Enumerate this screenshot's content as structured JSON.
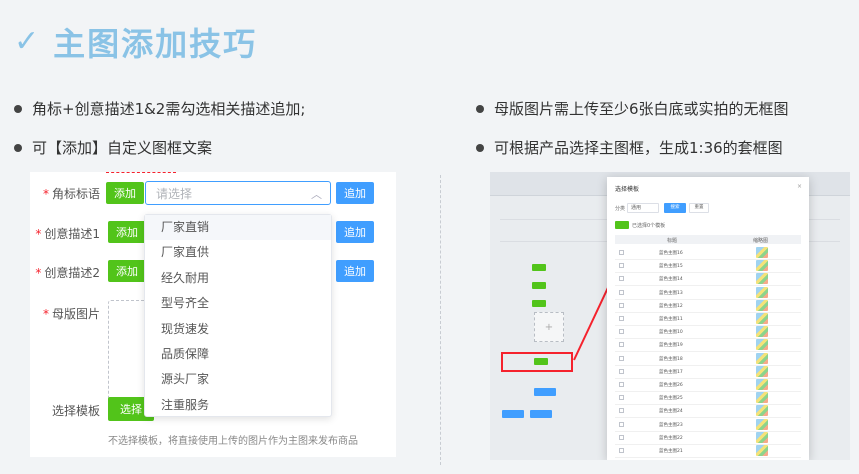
{
  "title": {
    "check": "✓",
    "text": "主图添加技巧"
  },
  "bullets": [
    "角标+创意描述1&2需勾选相关描述追加;",
    "可【添加】自定义图框文案",
    "母版图片需上传至少6张白底或实拍的无框图",
    "可根据产品选择主图框，生成1:36的套框图"
  ],
  "form": {
    "fields": [
      {
        "label": "角标标语",
        "required": true,
        "add_label": "添加"
      },
      {
        "label": "创意描述1",
        "required": true,
        "add_label": "添加"
      },
      {
        "label": "创意描述2",
        "required": true,
        "add_label": "添加"
      },
      {
        "label": "母版图片",
        "required": true
      }
    ],
    "append_label": "追加",
    "select_placeholder": "请选择",
    "dropdown_options": [
      "厂家直销",
      "厂家直供",
      "经久耐用",
      "型号齐全",
      "现货速发",
      "品质保障",
      "源头厂家",
      "注重服务"
    ],
    "template_label": "选择模板",
    "template_button": "选择",
    "hint": "不选择模板，将直接使用上传的图片作为主图来发布商品"
  },
  "screenshot": {
    "modal_title": "选择模板",
    "close": "×",
    "filter_label": "分类",
    "filter_value": "通用",
    "search_button": "搜索",
    "reset_button": "重置",
    "selected_count": "已选择0个模板",
    "col_title": "标题",
    "col_thumb": "缩略图",
    "rows": [
      "蓝色主图16",
      "蓝色主图15",
      "蓝色主图14",
      "蓝色主图13",
      "蓝色主图12",
      "蓝色主图11",
      "蓝色主图10",
      "蓝色主图19",
      "蓝色主图18",
      "蓝色主图17",
      "蓝色主图26",
      "蓝色主图25",
      "蓝色主图24",
      "蓝色主图23",
      "蓝色主图22",
      "蓝色主图21"
    ],
    "colors": {
      "green": "#52c41a",
      "blue": "#409eff",
      "red": "#f5222d"
    }
  }
}
